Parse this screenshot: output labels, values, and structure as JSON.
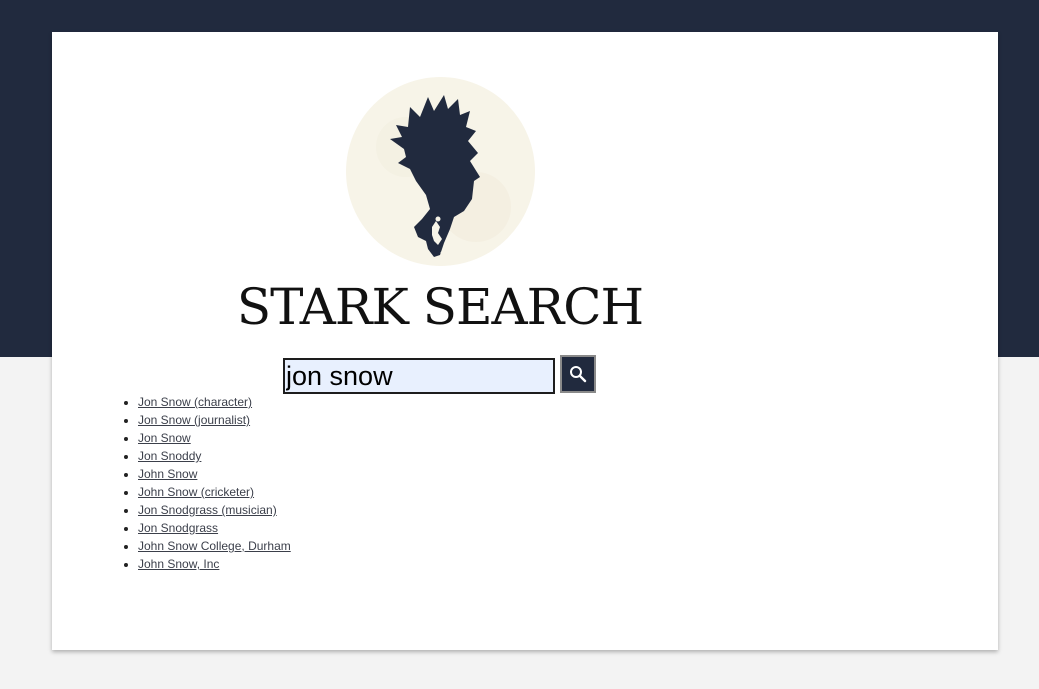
{
  "brand": {
    "title": "STARK SEARCH",
    "logo_icon": "direwolf-icon",
    "logo_circle_color": "#f7f4e8",
    "logo_wolf_color": "#212a3e"
  },
  "colors": {
    "header_band": "#212a3e",
    "page_background": "#f3f3f3",
    "card_background": "#ffffff",
    "input_background": "#e8f0fe"
  },
  "search": {
    "value": "jon snow",
    "placeholder": "",
    "button_icon": "search-icon"
  },
  "suggestions": [
    {
      "label": "Jon Snow (character)"
    },
    {
      "label": "Jon Snow (journalist)"
    },
    {
      "label": "Jon Snow"
    },
    {
      "label": "Jon Snoddy"
    },
    {
      "label": "John Snow"
    },
    {
      "label": "John Snow (cricketer)"
    },
    {
      "label": "Jon Snodgrass (musician)"
    },
    {
      "label": "Jon Snodgrass"
    },
    {
      "label": "John Snow College, Durham"
    },
    {
      "label": "John Snow, Inc"
    }
  ]
}
